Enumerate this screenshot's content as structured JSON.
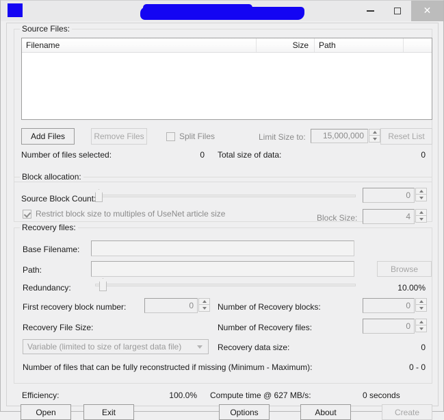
{
  "window": {
    "title_redacted": true,
    "icon": "app-icon-redacted",
    "minimize_label": "–",
    "maximize_label": "☐",
    "close_label": "✕"
  },
  "source_files": {
    "group_title": "Source Files:",
    "columns": [
      "Filename",
      "Size",
      "Path",
      ""
    ],
    "rows": [],
    "buttons": {
      "add_files": "Add Files",
      "remove_files": "Remove Files",
      "reset_list": "Reset List"
    },
    "split_files": {
      "label": "Split Files",
      "checked": false
    },
    "limit_size": {
      "label": "Limit Size to:",
      "value": "15,000,000"
    },
    "counts": {
      "files_selected_label": "Number of files selected:",
      "files_selected_value": "0",
      "total_size_label": "Total size of data:",
      "total_size_value": "0"
    }
  },
  "block_allocation": {
    "group_title": "Block allocation:",
    "source_block_count_label": "Source Block Count:",
    "source_block_count_value": "0",
    "restrict_label": "Restrict block size to multiples of UseNet article size",
    "restrict_checked": true,
    "block_size_label": "Block Size:",
    "block_size_value": "4"
  },
  "recovery_files": {
    "group_title": "Recovery files:",
    "base_filename_label": "Base Filename:",
    "base_filename_value": "",
    "path_label": "Path:",
    "path_value": "",
    "browse_label": "Browse",
    "redundancy_label": "Redundancy:",
    "redundancy_value": "10.00%",
    "first_recovery_block_label": "First recovery block number:",
    "first_recovery_block_value": "0",
    "recovery_blocks_label": "Number of Recovery blocks:",
    "recovery_blocks_value": "0",
    "recovery_file_size_label": "Recovery File Size:",
    "recovery_file_size_option": "Variable (limited to size of largest data file)",
    "recovery_files_count_label": "Number of Recovery files:",
    "recovery_files_count_value": "0",
    "recovery_data_size_label": "Recovery data size:",
    "recovery_data_size_value": "0",
    "reconstruct_label": "Number of files that can be fully reconstructed if missing (Minimum - Maximum):",
    "reconstruct_value": "0 - 0"
  },
  "status": {
    "efficiency_label": "Efficiency:",
    "efficiency_value": "100.0%",
    "compute_time_label": "Compute time @ 627 MB/s:",
    "compute_time_value": "0 seconds"
  },
  "footer": {
    "open": "Open",
    "exit": "Exit",
    "options": "Options",
    "about": "About",
    "create": "Create"
  }
}
